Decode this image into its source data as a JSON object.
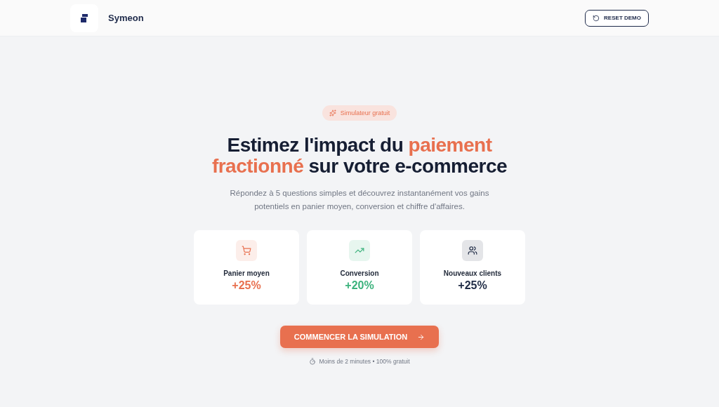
{
  "header": {
    "brand": "Symeon",
    "reset_button": "RESET DEMO"
  },
  "badge": "Simulateur gratuit",
  "headline": [
    {
      "text": "Estimez l'impact du ",
      "accent": false
    },
    {
      "text": "paiement fractionné",
      "accent": true
    },
    {
      "text": " sur votre e-commerce",
      "accent": false
    }
  ],
  "subtitle": "Répondez à 5 questions simples et découvrez instantanément vos gains potentiels en panier moyen, conversion et chiffre d'affaires.",
  "stats": [
    {
      "kind": "cart",
      "label": "Panier moyen",
      "value": "+25%",
      "color": "#e8704f"
    },
    {
      "kind": "trend",
      "label": "Conversion",
      "value": "+20%",
      "color": "#3bb27c"
    },
    {
      "kind": "users",
      "label": "Nouveaux clients",
      "value": "+25%",
      "color": "#1e2a44"
    }
  ],
  "cta": {
    "label": "COMMENCER LA SIMULATION",
    "note": "Moins de 2 minutes • 100% gratuit"
  }
}
